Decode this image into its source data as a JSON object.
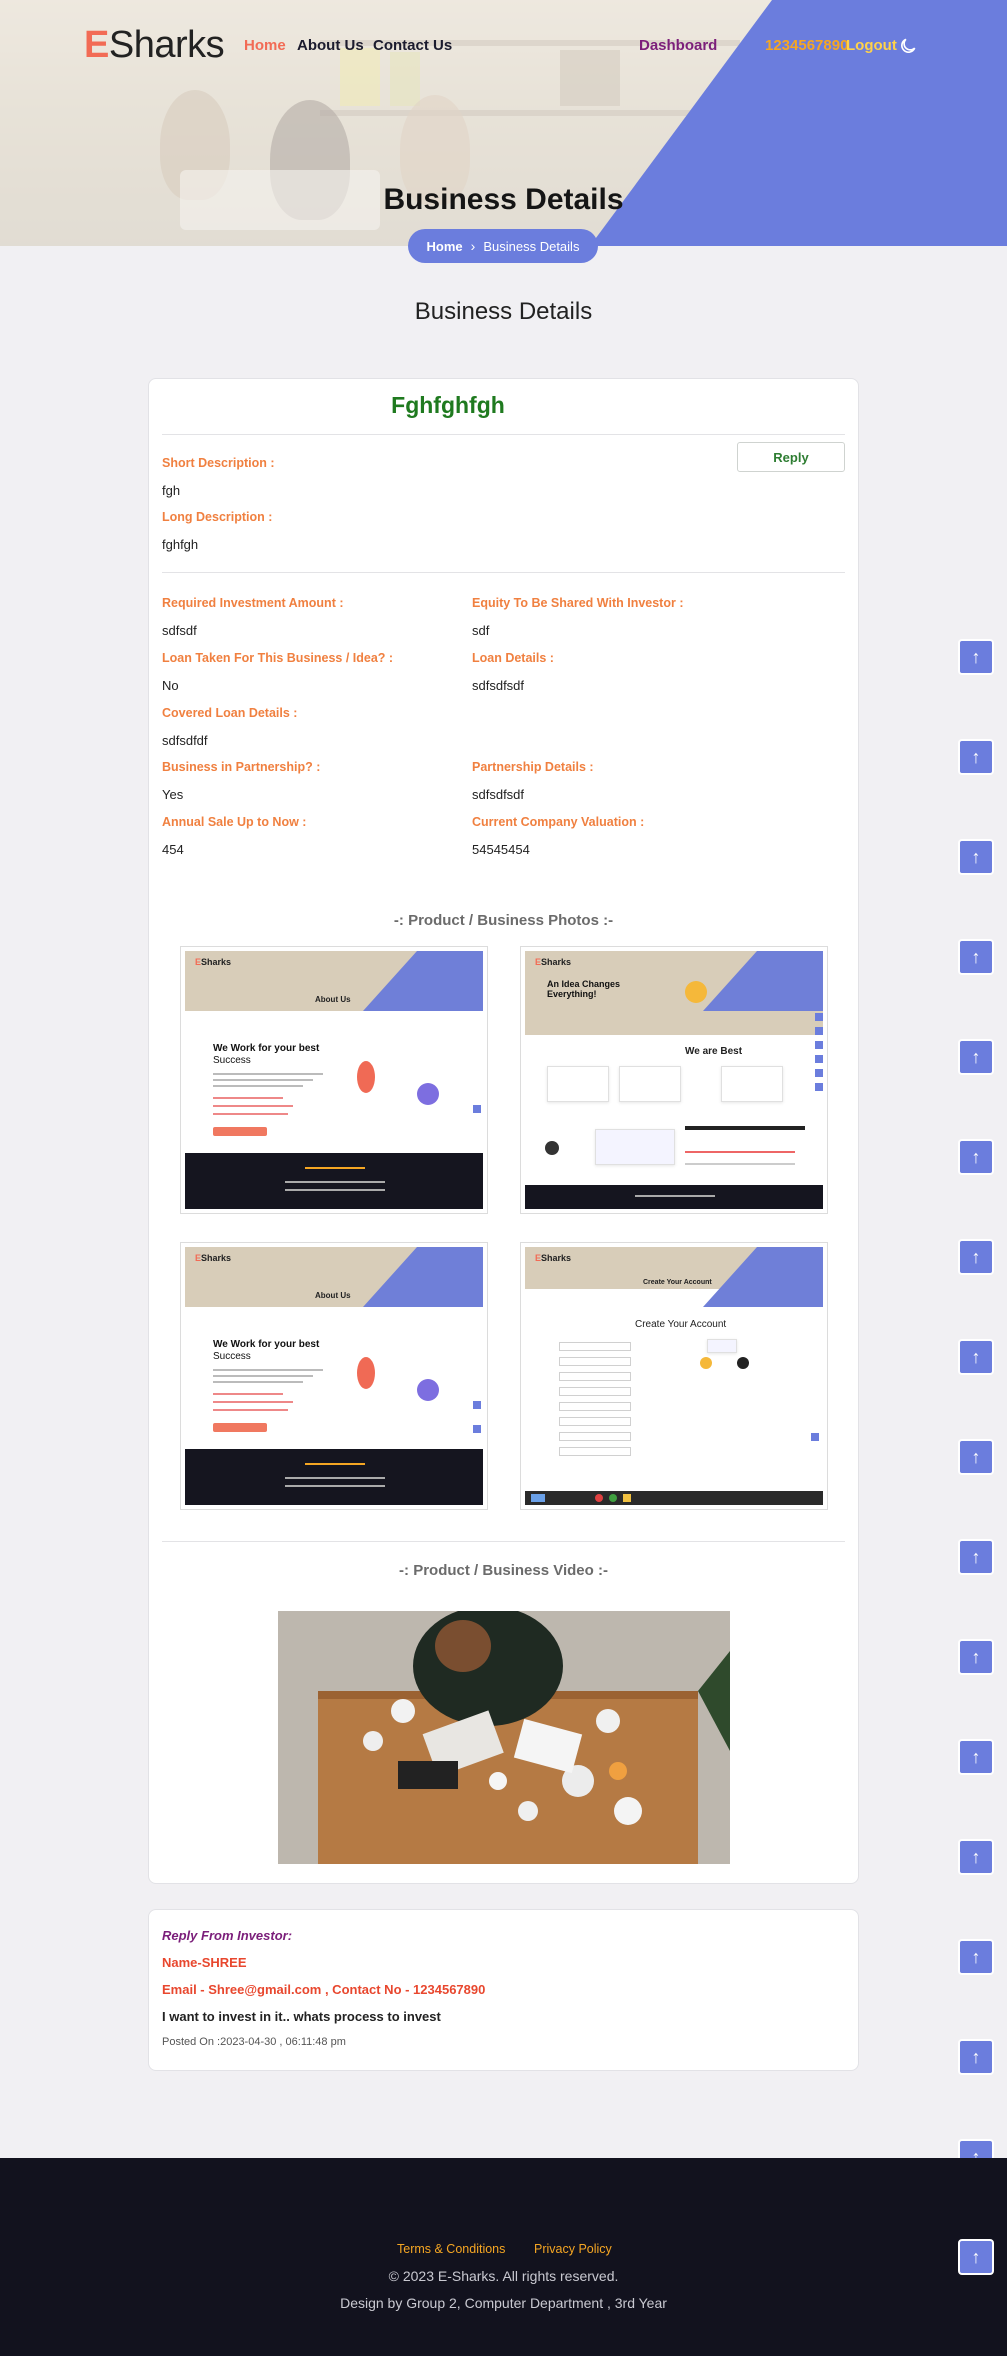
{
  "brand": {
    "letter": "E",
    "rest": "Sharks"
  },
  "nav": {
    "home": "Home",
    "about": "About Us",
    "contact": "Contact Us",
    "dashboard": "Dashboard",
    "phone": "1234567890",
    "logout": "Logout",
    "theme_icon": "moon-icon"
  },
  "hero": {
    "title": "Business Details",
    "breadcrumb_home": "Home",
    "breadcrumb_current": "Business Details"
  },
  "page_heading": "Business Details",
  "business": {
    "name": "Fghfghfgh",
    "reply_label": "Reply",
    "short_desc_label": "Short Description :",
    "short_desc": "fgh",
    "long_desc_label": "Long Description :",
    "long_desc": "fghfgh",
    "required_investment_label": "Required Investment Amount :",
    "required_investment": "sdfsdf",
    "equity_label": "Equity To Be Shared With Investor :",
    "equity": "sdf",
    "loan_taken_label": "Loan Taken For This Business / Idea? :",
    "loan_taken": "No",
    "loan_details_label": "Loan Details :",
    "loan_details": "sdfsdfsdf",
    "covered_loan_label": "Covered Loan Details :",
    "covered_loan": "sdfsdfdf",
    "partnership_label": "Business in Partnership? :",
    "partnership": "Yes",
    "partnership_details_label": "Partnership Details :",
    "partnership_details": "sdfsdfsdf",
    "annual_sale_label": "Annual Sale Up to Now :",
    "annual_sale": "454",
    "valuation_label": "Current Company Valuation :",
    "valuation": "54545454",
    "photos_title": "-: Product / Business Photos :-",
    "video_title": "-: Product / Business Video :-"
  },
  "thumbs": {
    "about_logo": "Sharks",
    "about_title": "About Us",
    "about_head_1": "We Work for your best",
    "about_head_2": "Success",
    "idea_title": "An Idea Changes Everything!",
    "best_title": "We are Best",
    "account_small": "Create Your Account",
    "account_title": "Create Your Account"
  },
  "reply": {
    "heading": "Reply From Investor:",
    "name": "Name-SHREE",
    "contact": "Email - Shree@gmail.com , Contact No - 1234567890",
    "message": "I want to invest in it.. whats process to invest",
    "posted": "Posted On :2023-04-30 , 06:11:48 pm"
  },
  "scroll_button": "↑",
  "footer": {
    "terms": "Terms & Conditions",
    "privacy": "Privacy Policy",
    "copyright": "© 2023 E-Sharks. All rights reserved.",
    "design": "Design by Group 2, Computer Department , 3rd Year"
  },
  "colors": {
    "accent": "#6b7ddd",
    "brand_orange": "#f26b55",
    "label_orange": "#f08040",
    "title_green": "#1f7a1f",
    "footer_bg": "#12121e"
  }
}
